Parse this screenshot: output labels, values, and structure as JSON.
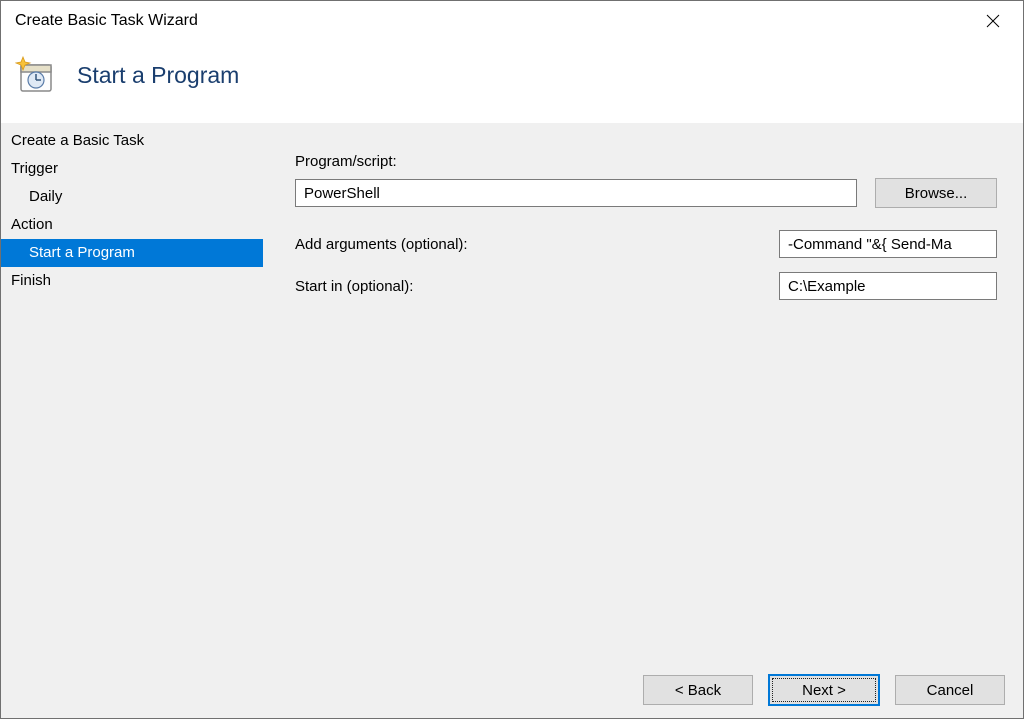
{
  "titlebar": {
    "title": "Create Basic Task Wizard"
  },
  "page": {
    "title": "Start a Program"
  },
  "sidebar": {
    "items": [
      {
        "label": "Create a Basic Task",
        "indent": false,
        "selected": false
      },
      {
        "label": "Trigger",
        "indent": false,
        "selected": false
      },
      {
        "label": "Daily",
        "indent": true,
        "selected": false
      },
      {
        "label": "Action",
        "indent": false,
        "selected": false
      },
      {
        "label": "Start a Program",
        "indent": true,
        "selected": true
      },
      {
        "label": "Finish",
        "indent": false,
        "selected": false
      }
    ]
  },
  "form": {
    "program_label": "Program/script:",
    "program_value": "PowerShell",
    "browse_label": "Browse...",
    "args_label": "Add arguments (optional):",
    "args_value": "-Command \"&{ Send-Ma",
    "startin_label": "Start in (optional):",
    "startin_value": "C:\\Example"
  },
  "buttons": {
    "back": "< Back",
    "next": "Next >",
    "cancel": "Cancel"
  }
}
